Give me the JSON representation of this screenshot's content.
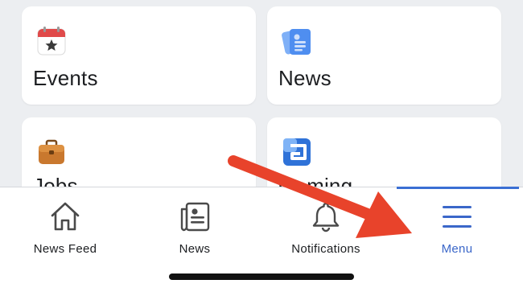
{
  "cards": [
    {
      "label": "Events",
      "icon": "calendar-star-icon"
    },
    {
      "label": "News",
      "icon": "newspaper-icon"
    },
    {
      "label": "Jobs",
      "icon": "briefcase-icon"
    },
    {
      "label": "Gaming",
      "icon": "gaming-icon"
    }
  ],
  "tabbar": {
    "tabs": [
      {
        "label": "News Feed",
        "icon": "home-icon"
      },
      {
        "label": "News",
        "icon": "newspaper-icon"
      },
      {
        "label": "Notifications",
        "icon": "bell-icon"
      },
      {
        "label": "Menu",
        "icon": "hamburger-menu-icon",
        "active": true
      }
    ]
  },
  "colors": {
    "background": "#eceef1",
    "card": "#ffffff",
    "active_tab": "#3b67c9",
    "annotation_arrow": "#e8432b",
    "events_icon_red": "#e04a4a",
    "news_icon_blue": "#4f8ef0",
    "jobs_icon_brown": "#c9782e",
    "gaming_icon_blue": "#2f72d8"
  }
}
